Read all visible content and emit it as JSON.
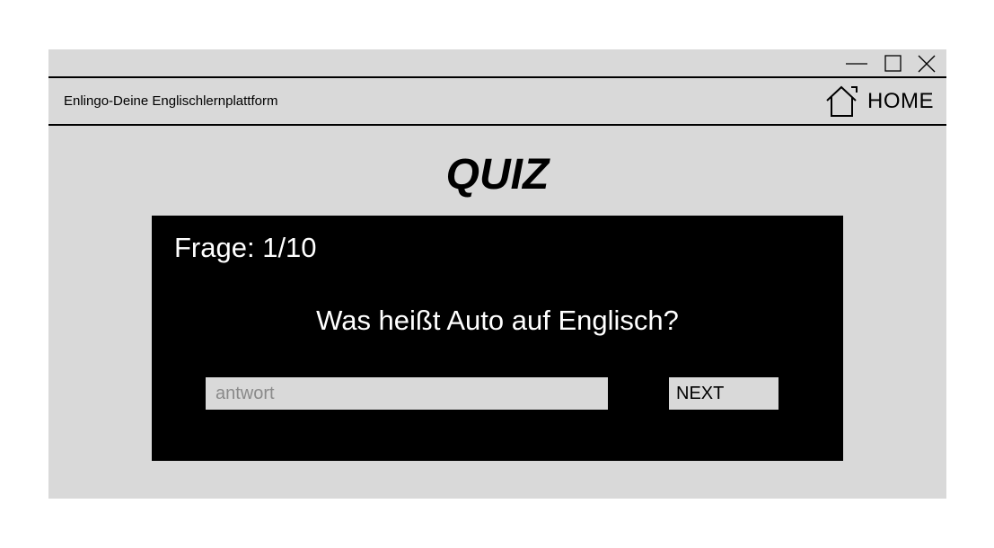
{
  "window": {
    "background": "#d9d9d9",
    "controls": {
      "minimize_icon": "minimize-icon",
      "maximize_icon": "maximize-icon",
      "close_icon": "close-icon"
    }
  },
  "navbar": {
    "app_title": "Enlingo-Deine Englischlernplattform",
    "home_icon": "home-icon",
    "home_label": "HOME"
  },
  "page": {
    "title": "QUIZ"
  },
  "quiz": {
    "counter": "Frage: 1/10",
    "question": "Was heißt Auto auf Englisch?",
    "answer_value": "",
    "answer_placeholder": "antwort",
    "next_label": "NEXT",
    "card_color": "#000000"
  }
}
